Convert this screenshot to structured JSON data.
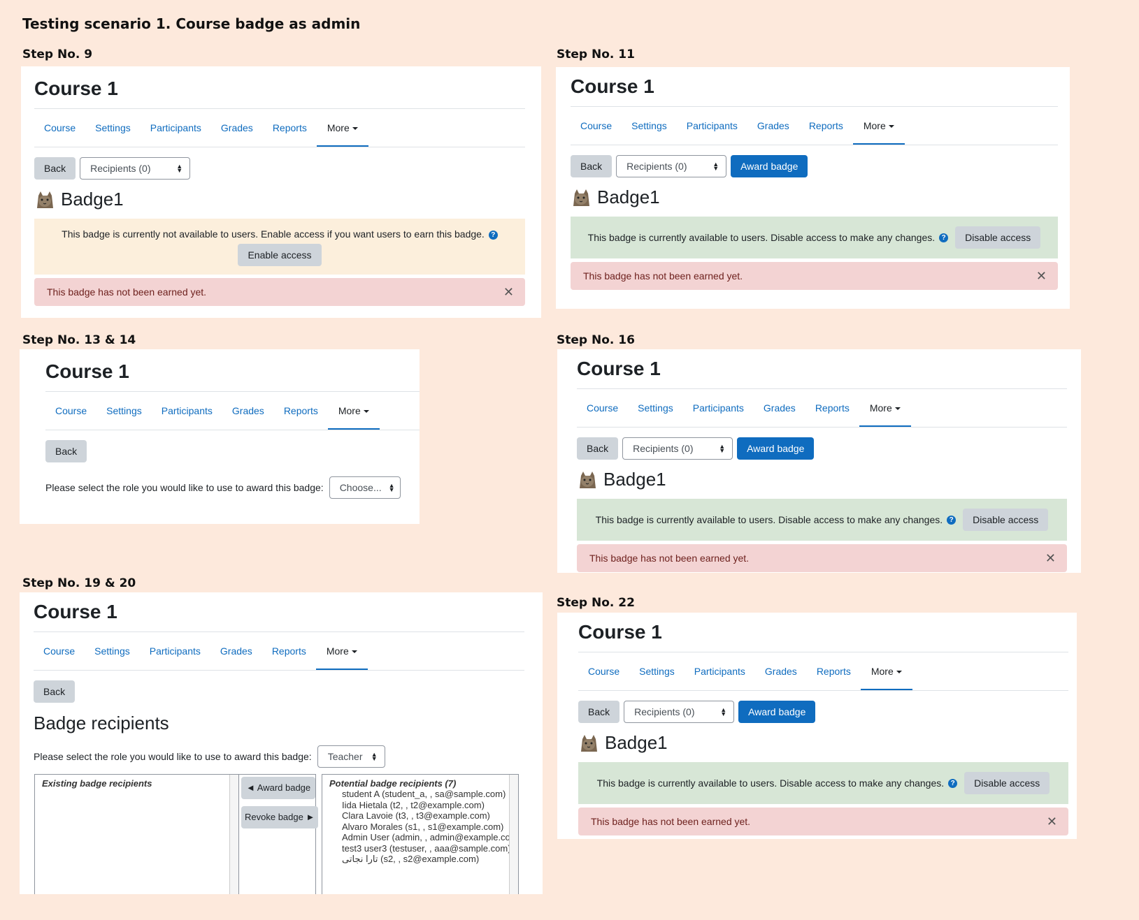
{
  "doc_title": "Testing scenario 1. Course badge as admin",
  "common": {
    "course_title": "Course 1",
    "nav": [
      "Course",
      "Settings",
      "Participants",
      "Grades",
      "Reports",
      "More"
    ],
    "back": "Back",
    "recipients_select": "Recipients (0)",
    "award_badge": "Award badge",
    "badge_name": "Badge1",
    "not_earned": "This badge has not been earned yet.",
    "available_msg": "This badge is currently available to users. Disable access to make any changes.",
    "disable_access": "Disable access",
    "close_symbol": "✕",
    "help_symbol": "?"
  },
  "step9": {
    "label": "Step No. 9",
    "unavailable_msg": "This badge is currently not available to users. Enable access if you want users to earn this badge.",
    "enable_access": "Enable access"
  },
  "step11": {
    "label": "Step No. 11"
  },
  "step13": {
    "label": "Step No. 13 & 14",
    "role_prompt": "Please select the role you would like to use to award this badge:",
    "role_select": "Choose..."
  },
  "step16": {
    "label": "Step No. 16"
  },
  "step19": {
    "label": "Step No. 19 & 20",
    "heading": "Badge recipients",
    "role_prompt": "Please select the role you would like to use to award this badge:",
    "role_select": "Teacher",
    "existing_title": "Existing badge recipients",
    "award_arrow_btn": "◄ Award badge",
    "revoke_btn": "Revoke badge ►",
    "potential_title": "Potential badge recipients (7)",
    "potential": [
      "student A (student_a, , sa@sample.com)",
      "Iida Hietala (t2, , t2@example.com)",
      "Clara Lavoie (t3, , t3@example.com)",
      "Alvaro Morales (s1, , s1@example.com)",
      "Admin User (admin, , admin@example.co",
      "test3 user3 (testuser, , aaa@sample.com)",
      "تارا نجاتی (s2, , s2@example.com)"
    ]
  },
  "step22": {
    "label": "Step No. 22"
  },
  "colors": {
    "page_bg": "#fde9dc",
    "link": "#0f6cbf",
    "success_bg": "#d7e6d6",
    "warn_bg": "#fcefdc",
    "danger_bg": "#f3d3d3"
  },
  "icons": [
    "cat-badge-icon",
    "help-icon",
    "close-icon",
    "select-arrows-icon",
    "caret-down-icon"
  ]
}
